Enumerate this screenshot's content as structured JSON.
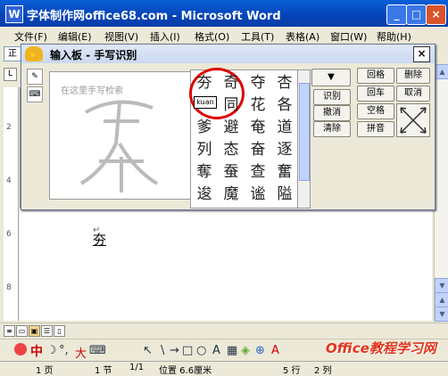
{
  "window": {
    "title": "字体制作网office68.com - Microsoft Word",
    "app_icon": "W",
    "minimize": "_",
    "maximize": "□",
    "close": "×"
  },
  "menu": [
    "文件(F)",
    "编辑(E)",
    "视图(V)",
    "插入(I)",
    "格式(O)",
    "工具(T)",
    "表格(A)",
    "窗口(W)",
    "帮助(H)"
  ],
  "style_box": "正",
  "ruler_button": "L",
  "vruler_numbers": [
    "2",
    "4",
    "6",
    "8"
  ],
  "ime_panel": {
    "title": "输入板 - 手写识别",
    "close": "×",
    "write_hint": "在这里手写检索",
    "candidates": [
      [
        "夯",
        "奇",
        "夺",
        "杏"
      ],
      [
        "",
        "同",
        "花",
        "各"
      ],
      [
        "爹",
        "避",
        "奄",
        "道"
      ],
      [
        "列",
        "态",
        "奋",
        "逐"
      ],
      [
        "奪",
        "蚕",
        "查",
        "奮"
      ],
      [
        "逡",
        "魔",
        "谧",
        "隘"
      ]
    ],
    "pinyin_hint": "kuan",
    "dropdown_arrow": "▼",
    "buttons_mid": [
      "识别",
      "撤消",
      "清除"
    ],
    "buttons_right": [
      [
        "回格",
        "删除"
      ],
      [
        "回车",
        "取消"
      ],
      [
        "空格",
        "拼音"
      ]
    ]
  },
  "document": {
    "return_mark": "↵",
    "typed_char": "夯"
  },
  "drawbar": {
    "ime_label": "中",
    "tools": [
      "☽",
      "°,",
      "大",
      "⌨",
      "↖",
      "\\",
      "→",
      "□",
      "○",
      "A",
      "▦",
      "◈",
      "⊕",
      "A"
    ]
  },
  "statusbar": {
    "page": "1 页",
    "section": "1 节",
    "page_of": "1/1",
    "position": "位置 6.6厘米",
    "line": "5 行",
    "col": "2 列"
  },
  "watermark": "Office教程学习网",
  "colors": {
    "title_bar": "#0a4fc6",
    "highlight_circle": "#e00000",
    "ime_label": "#cc0000"
  }
}
